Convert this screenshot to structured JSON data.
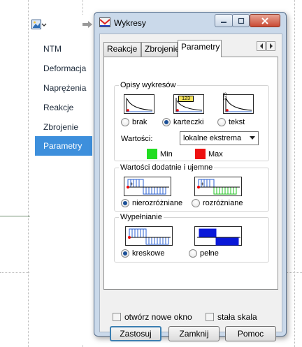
{
  "sidebar": {
    "items": [
      {
        "label": "NTM",
        "active": false
      },
      {
        "label": "Deformacja",
        "active": false
      },
      {
        "label": "Naprężenia",
        "active": false
      },
      {
        "label": "Reakcje",
        "active": false
      },
      {
        "label": "Zbrojenie",
        "active": false
      },
      {
        "label": "Parametry",
        "active": true
      }
    ],
    "toolbar": {
      "view_icon": "picture-icon",
      "dropdown_icon": "chevron-down-icon",
      "arrow_icon": "arrow-right-icon"
    }
  },
  "dialog": {
    "title": "Wykresy",
    "title_icon": "chart-icon",
    "tabs": [
      {
        "label": "Reakcje",
        "active": false
      },
      {
        "label": "Zbrojenie",
        "active": false
      },
      {
        "label": "Parametry",
        "active": true
      }
    ],
    "opisy": {
      "title": "Opisy wykresów",
      "options": [
        {
          "label": "brak",
          "selected": false
        },
        {
          "label": "karteczki",
          "selected": true
        },
        {
          "label": "tekst",
          "selected": false
        }
      ],
      "thumb_label_karteczki": "123",
      "thumb_label_tekst": "123"
    },
    "wartosci": {
      "label": "Wartości:",
      "select_value": "lokalne ekstrema",
      "min_label": "Min",
      "max_label": "Max",
      "min_color": "#22dd22",
      "max_color": "#ee1111"
    },
    "dodatnie": {
      "title": "Wartości dodatnie i ujemne",
      "options": [
        {
          "label": "nierozróżniane",
          "selected": true
        },
        {
          "label": "rozróżniane",
          "selected": false
        }
      ]
    },
    "wypelnianie": {
      "title": "Wypełnianie",
      "options": [
        {
          "label": "kreskowe",
          "selected": true
        },
        {
          "label": "pełne",
          "selected": false
        }
      ]
    },
    "footer": {
      "checkbox_open_new": "otwórz nowe okno",
      "checkbox_fixed_scale": "stała  skala",
      "apply": "Zastosuj",
      "close": "Zamknij",
      "help": "Pomoc"
    }
  }
}
